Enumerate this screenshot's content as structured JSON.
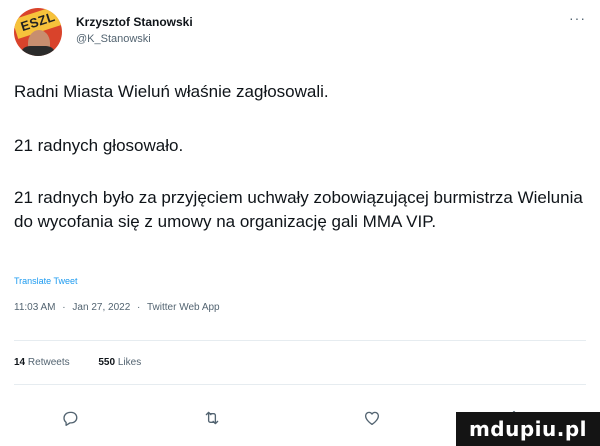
{
  "author": {
    "name": "Krzysztof Stanowski",
    "handle": "@K_Stanowski",
    "avatar_badge_text": "ESZL"
  },
  "menu_icon": "more-horizontal-icon",
  "tweet": {
    "paragraphs": [
      "Radni Miasta Wieluń właśnie zagłosowali.",
      "21 radnych głosowało.",
      "21 radnych było za przyjęciem uchwały zobowiązującej burmistrza Wielunia do wycofania się z umowy na organizację gali MMA VIP."
    ],
    "translate_link": "Translate Tweet"
  },
  "meta": {
    "time": "11:03 AM",
    "date": "Jan 27, 2022",
    "source": "Twitter Web App",
    "separator": "·"
  },
  "stats": {
    "retweets_count": "14",
    "retweets_label": "Retweets",
    "likes_count": "550",
    "likes_label": "Likes"
  },
  "actions": {
    "reply_icon": "reply-icon",
    "retweet_icon": "retweet-icon",
    "like_icon": "heart-icon",
    "share_icon": "share-icon"
  },
  "watermark": {
    "text": "mdupiu.pl"
  },
  "colors": {
    "text": "#0f1419",
    "muted": "#536471",
    "link": "#1d9bf0",
    "divider": "#e6ecf0"
  }
}
